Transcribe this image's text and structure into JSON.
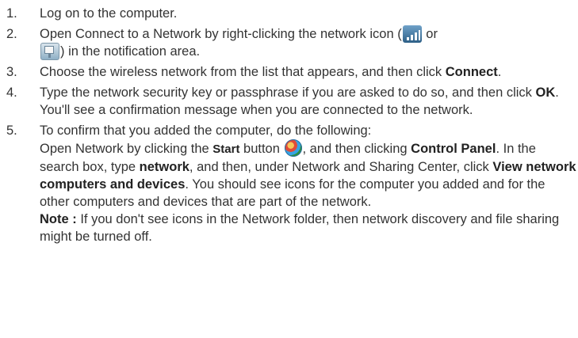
{
  "steps": [
    {
      "num": "1.",
      "text": "Log on to the computer."
    },
    {
      "num": "2.",
      "t1": "Open Connect to a Network by right-clicking the network icon (",
      "t2": " or",
      "t3": ") in the notification area.",
      "icons": [
        "signal-strength-icon",
        "network-disconnected-icon"
      ]
    },
    {
      "num": "3.",
      "t1": "Choose the wireless network from the list that appears, and then click ",
      "b1": "Connect",
      "t2": "."
    },
    {
      "num": "4.",
      "t1": "Type the network security key or passphrase if you are asked to do so, and then click ",
      "b1": "OK",
      "t2": ". You'll see a confirmation message when you are connected to the network."
    },
    {
      "num": "5.",
      "intro": "To confirm that you added the computer, do the following:",
      "t1": "Open Network by clicking the ",
      "b_start": "Start",
      "t2": " button ",
      "t3": ", and then clicking ",
      "b_cp": "Control Panel",
      "t4": ". In the search box, type ",
      "b_net": "network",
      "t5": ", and then, under Network and Sharing Center, click ",
      "b_view": "View network computers and devices",
      "t6": ". You should see icons for the computer you added and for the other computers and devices that are part of the network.",
      "note_label": "Note :",
      "note_text": " If you don't see icons in the Network folder, then network discovery and file sharing might be turned off.",
      "icons": [
        "start-orb-icon"
      ]
    }
  ]
}
